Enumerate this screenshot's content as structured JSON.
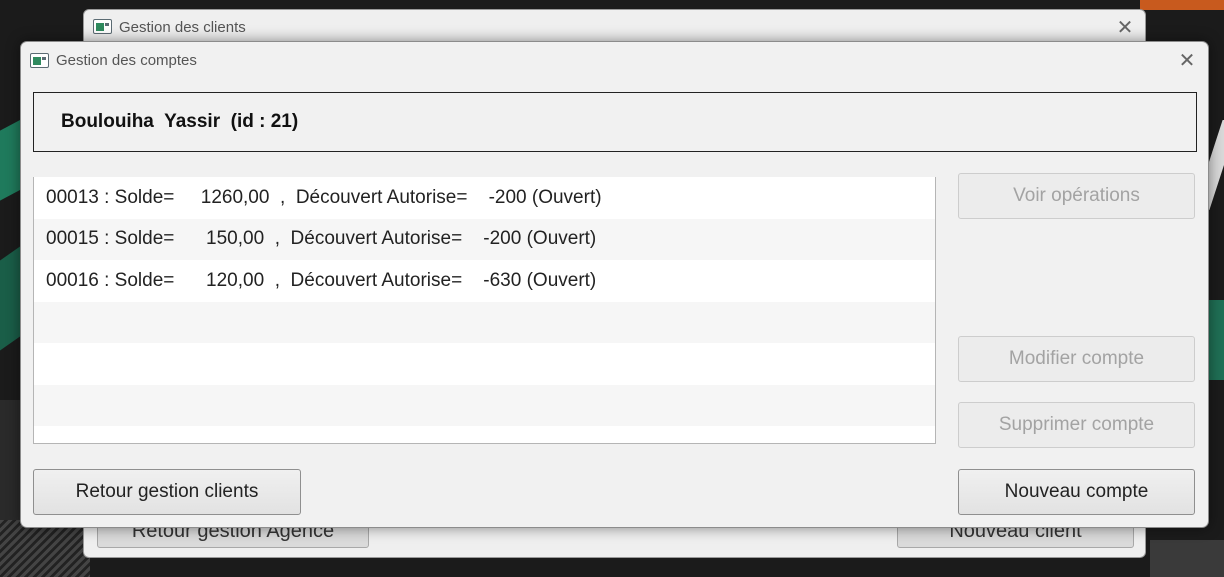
{
  "back_window": {
    "title": "Gestion des clients",
    "left_button": "Retour gestion Agence",
    "right_button": "Nouveau client"
  },
  "front_window": {
    "title": "Gestion des comptes",
    "client_header": "Boulouiha  Yassir  (id : 21)",
    "accounts": [
      {
        "text": "00013 : Solde=     1260,00  ,  Découvert Autorise=    -200 (Ouvert)"
      },
      {
        "text": "00015 : Solde=      150,00  ,  Découvert Autorise=    -200 (Ouvert)"
      },
      {
        "text": "00016 : Solde=      120,00  ,  Découvert Autorise=    -630 (Ouvert)"
      },
      {
        "text": ""
      },
      {
        "text": ""
      },
      {
        "text": ""
      }
    ],
    "buttons": {
      "voir_operations": "Voir opérations",
      "modifier_compte": "Modifier compte",
      "supprimer_compte": "Supprimer compte",
      "nouveau_compte": "Nouveau compte",
      "retour_gestion_clients": "Retour gestion clients"
    }
  },
  "icons": {
    "app": "app-window-icon",
    "close": "close-icon"
  }
}
